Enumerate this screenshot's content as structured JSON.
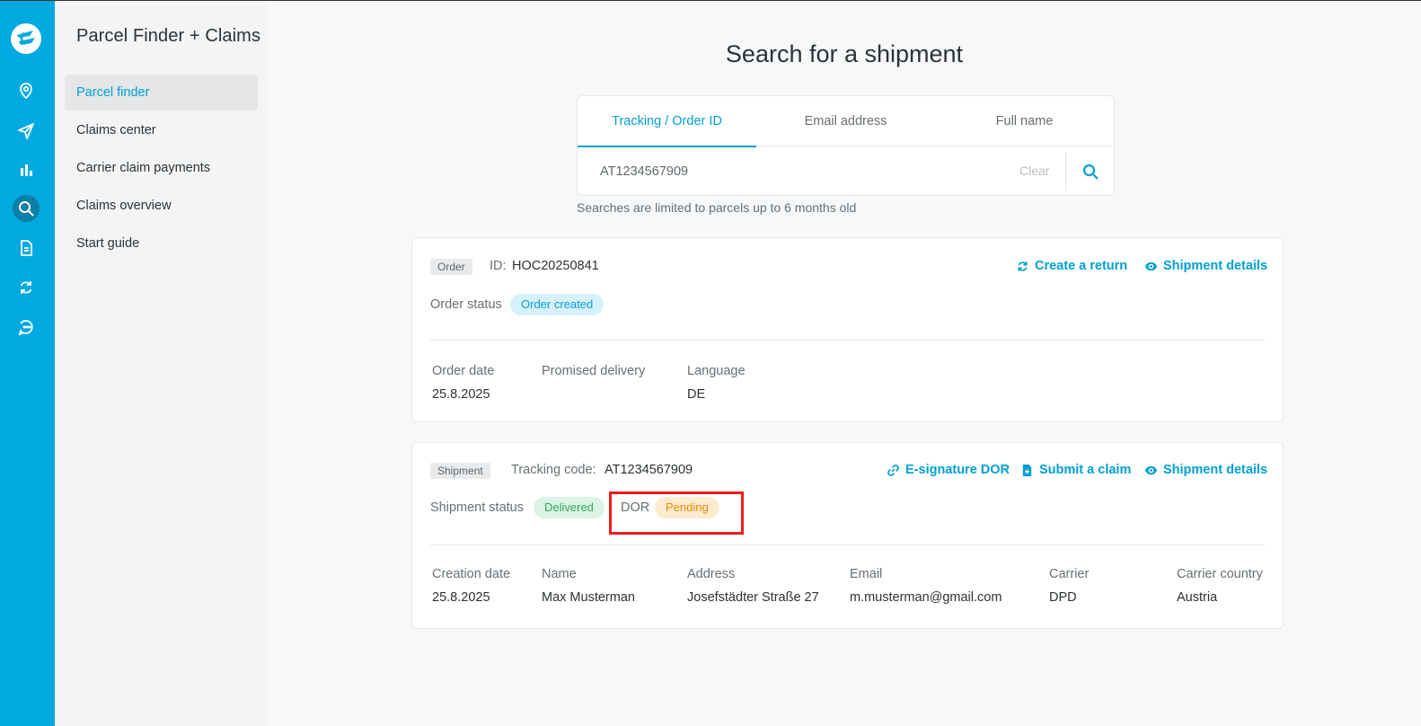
{
  "rail": {
    "items": [
      {
        "icon": "location-pin-icon"
      },
      {
        "icon": "paper-plane-icon"
      },
      {
        "icon": "bar-chart-icon"
      },
      {
        "icon": "search-icon",
        "active": true
      },
      {
        "icon": "document-icon"
      },
      {
        "icon": "refresh-icon"
      },
      {
        "icon": "chat-history-icon"
      }
    ]
  },
  "sidebar": {
    "title": "Parcel Finder + Claims",
    "items": [
      {
        "label": "Parcel finder",
        "active": true
      },
      {
        "label": "Claims center"
      },
      {
        "label": "Carrier claim payments"
      },
      {
        "label": "Claims overview"
      },
      {
        "label": "Start guide"
      }
    ]
  },
  "main": {
    "title": "Search for a shipment",
    "tabs": [
      {
        "label": "Tracking / Order ID",
        "active": true
      },
      {
        "label": "Email address"
      },
      {
        "label": "Full name"
      }
    ],
    "search": {
      "value": "AT1234567909",
      "clear_label": "Clear"
    },
    "hint": "Searches are limited to parcels up to 6 months old"
  },
  "order": {
    "tag": "Order",
    "id_label": "ID:",
    "id_value": "HOC20250841",
    "actions": {
      "create_return": "Create a return",
      "details": "Shipment details"
    },
    "status_label": "Order status",
    "status": "Order created",
    "fields": [
      {
        "label": "Order date",
        "value": "25.8.2025"
      },
      {
        "label": "Promised delivery",
        "value": ""
      },
      {
        "label": "Language",
        "value": "DE"
      }
    ]
  },
  "shipment": {
    "tag": "Shipment",
    "tracking_label": "Tracking code:",
    "tracking_value": "AT1234567909",
    "actions": {
      "esign": "E-signature DOR",
      "claim": "Submit a claim",
      "details": "Shipment details"
    },
    "status_label": "Shipment status",
    "status": "Delivered",
    "dor_label": "DOR",
    "dor_status": "Pending",
    "fields": [
      {
        "label": "Creation date",
        "value": "25.8.2025"
      },
      {
        "label": "Name",
        "value": "Max Musterman"
      },
      {
        "label": "Address",
        "value": "Josefstädter Straße 27"
      },
      {
        "label": "Email",
        "value": "m.musterman@gmail.com"
      },
      {
        "label": "Carrier",
        "value": "DPD"
      },
      {
        "label": "Carrier country",
        "value": "Austria"
      }
    ]
  },
  "colors": {
    "accent": "#00a9e0",
    "highlight": "#ee1c1c"
  }
}
